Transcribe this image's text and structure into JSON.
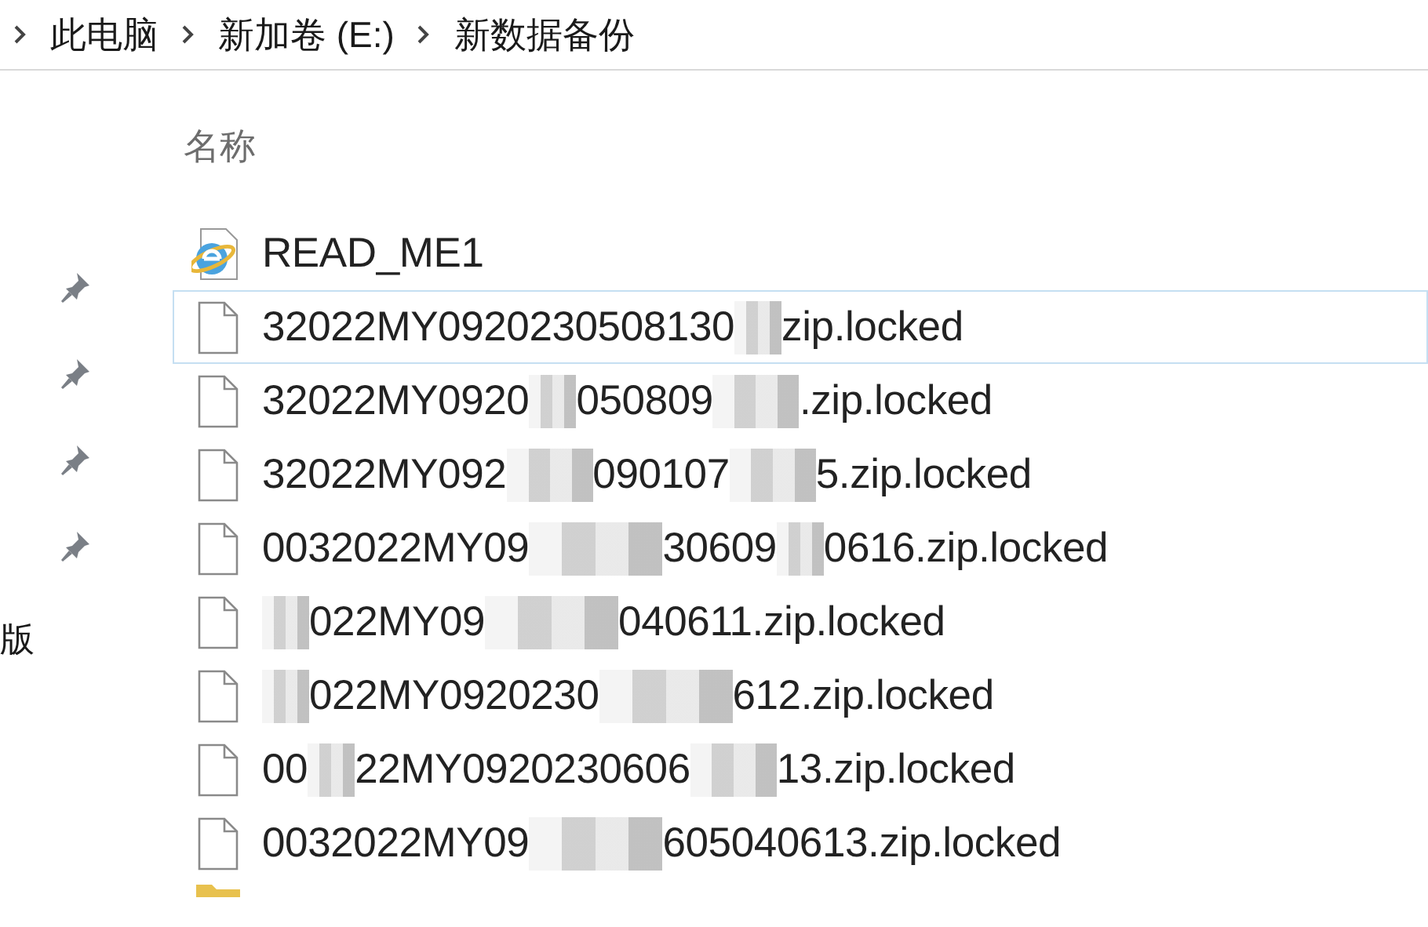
{
  "breadcrumb": [
    {
      "label": "此电脑"
    },
    {
      "label": "新加卷 (E:)"
    },
    {
      "label": "新数据备份"
    }
  ],
  "nav": {
    "pins": [
      {
        "kind": "pin"
      },
      {
        "kind": "pin"
      },
      {
        "kind": "pin"
      },
      {
        "kind": "pin"
      }
    ],
    "cut_label": "版"
  },
  "column_header": "名称",
  "files": [
    {
      "kind": "web",
      "focused": false,
      "parts": [
        {
          "kind": "text",
          "text": "READ_ME1"
        }
      ]
    },
    {
      "kind": "file",
      "focused": true,
      "parts": [
        {
          "kind": "text",
          "text": "32022MY0920230508130"
        },
        {
          "kind": "mosaic-short"
        },
        {
          "kind": "text",
          "text": "zip.locked"
        }
      ]
    },
    {
      "kind": "file",
      "focused": false,
      "parts": [
        {
          "kind": "text",
          "text": "32022MY0920"
        },
        {
          "kind": "mosaic-short"
        },
        {
          "kind": "text",
          "text": "050809"
        },
        {
          "kind": "mosaic-medium"
        },
        {
          "kind": "text",
          "text": ".zip.locked"
        }
      ]
    },
    {
      "kind": "file",
      "focused": false,
      "parts": [
        {
          "kind": "text",
          "text": "32022MY092"
        },
        {
          "kind": "mosaic-medium"
        },
        {
          "kind": "text",
          "text": "090107"
        },
        {
          "kind": "mosaic-medium"
        },
        {
          "kind": "text",
          "text": "5.zip.locked"
        }
      ]
    },
    {
      "kind": "file",
      "focused": false,
      "parts": [
        {
          "kind": "text",
          "text": "0032022MY09"
        },
        {
          "kind": "mosaic-long"
        },
        {
          "kind": "text",
          "text": "30609"
        },
        {
          "kind": "mosaic-short"
        },
        {
          "kind": "text",
          "text": "0616.zip.locked"
        }
      ]
    },
    {
      "kind": "file",
      "focused": false,
      "parts": [
        {
          "kind": "mosaic-short"
        },
        {
          "kind": "text",
          "text": "022MY09"
        },
        {
          "kind": "mosaic-long"
        },
        {
          "kind": "text",
          "text": "040611.zip.locked"
        }
      ]
    },
    {
      "kind": "file",
      "focused": false,
      "parts": [
        {
          "kind": "mosaic-short"
        },
        {
          "kind": "text",
          "text": "022MY0920230"
        },
        {
          "kind": "mosaic-long"
        },
        {
          "kind": "text",
          "text": "612.zip.locked"
        }
      ]
    },
    {
      "kind": "file",
      "focused": false,
      "parts": [
        {
          "kind": "text",
          "text": "00"
        },
        {
          "kind": "mosaic-short"
        },
        {
          "kind": "text",
          "text": "22MY0920230606"
        },
        {
          "kind": "mosaic-medium"
        },
        {
          "kind": "text",
          "text": "13.zip.locked"
        }
      ]
    },
    {
      "kind": "file",
      "focused": false,
      "parts": [
        {
          "kind": "text",
          "text": "0032022MY09"
        },
        {
          "kind": "mosaic-long"
        },
        {
          "kind": "text",
          "text": "605040613.zip.locked"
        }
      ]
    },
    {
      "kind": "folder",
      "focused": false
    }
  ]
}
